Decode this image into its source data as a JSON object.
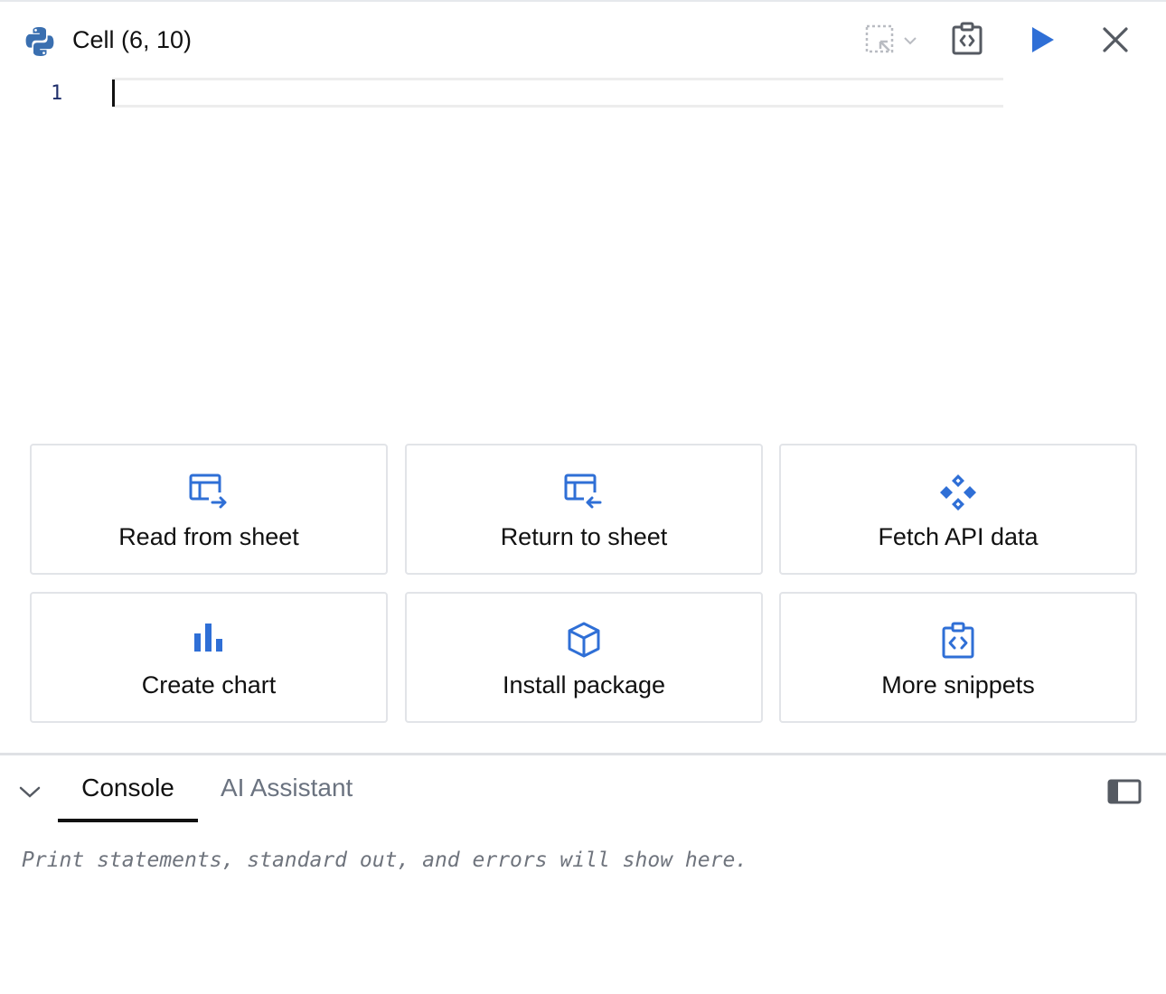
{
  "header": {
    "title": "Cell (6, 10)",
    "icons": {
      "language": "python-icon",
      "selection": "cell-selection-icon",
      "snippets": "code-snippet-icon",
      "run": "play-icon",
      "close": "close-icon"
    }
  },
  "editor": {
    "line_numbers": [
      "1"
    ],
    "content": ""
  },
  "snippets": [
    {
      "label": "Read from sheet",
      "icon": "table-arrow-right-icon"
    },
    {
      "label": "Return to sheet",
      "icon": "table-arrow-left-icon"
    },
    {
      "label": "Fetch API data",
      "icon": "api-diamond-icon"
    },
    {
      "label": "Create chart",
      "icon": "bar-chart-icon"
    },
    {
      "label": "Install package",
      "icon": "package-cube-icon"
    },
    {
      "label": "More snippets",
      "icon": "code-snippet-icon"
    }
  ],
  "bottom_panel": {
    "tabs": [
      {
        "label": "Console",
        "active": true
      },
      {
        "label": "AI Assistant",
        "active": false
      }
    ],
    "console_placeholder": "Print statements, standard out, and errors will show here."
  },
  "colors": {
    "accent": "#2f6fd6",
    "icon_gray": "#555a62",
    "python_blue": "#3a6fb0"
  }
}
